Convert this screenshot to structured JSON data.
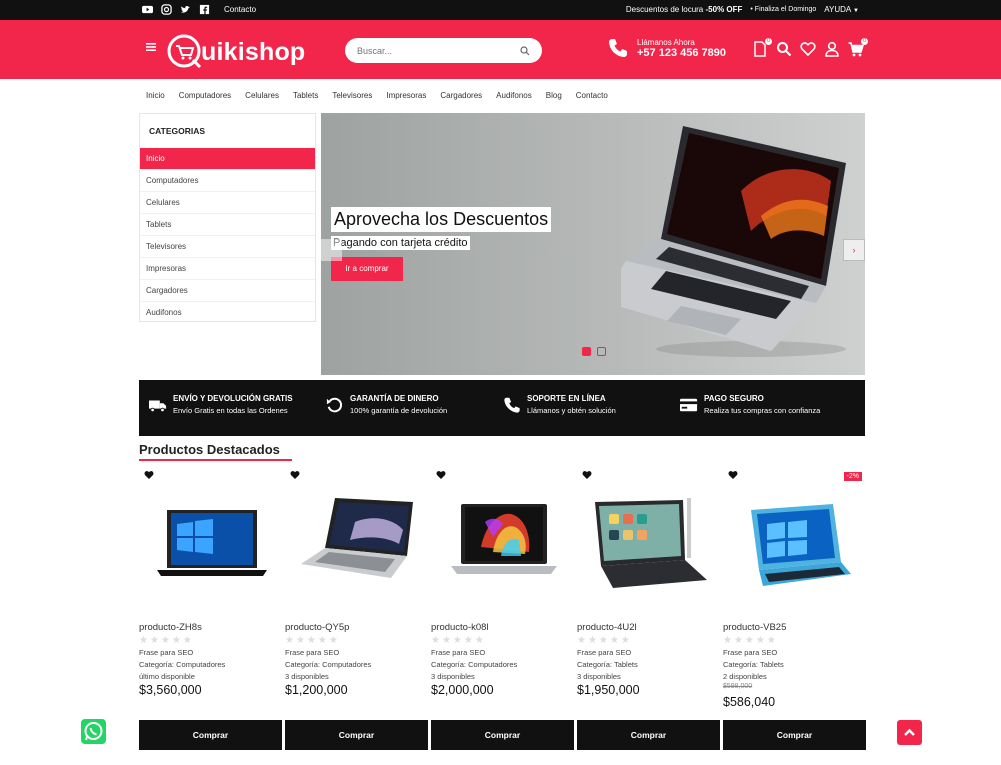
{
  "topbar": {
    "social_icons": [
      "youtube-icon",
      "instagram-icon",
      "twitter-icon",
      "facebook-icon"
    ],
    "contact": "Contacto",
    "promo_prefix": "Descuentos de locura",
    "promo_value": "-50% OFF",
    "promo_suffix": "• Finaliza el Domingo",
    "help": "AYUDA"
  },
  "header": {
    "logo_text": "uikishop",
    "search_placeholder": "Buscar...",
    "call_label": "Llámanos Ahora",
    "phone": "+57 123 456 7890",
    "compare_count": "0",
    "cart_count": "0",
    "icons": [
      "compare-icon",
      "search-icon",
      "heart-icon",
      "user-icon",
      "cart-icon"
    ]
  },
  "nav": [
    "Inicio",
    "Computadores",
    "Celulares",
    "Tablets",
    "Televisores",
    "Impresoras",
    "Cargadores",
    "Audifonos",
    "Blog",
    "Contacto"
  ],
  "sidebar": {
    "title": "CATEGORIAS",
    "items": [
      "Inicio",
      "Computadores",
      "Celulares",
      "Tablets",
      "Televisores",
      "Impresoras",
      "Cargadores",
      "Audifonos"
    ]
  },
  "hero": {
    "title": "Aprovecha los Descuentos",
    "subtitle": "Pagando con tarjeta crédito",
    "button": "Ir a comprar",
    "next": "›"
  },
  "features": [
    {
      "icon": "truck-icon",
      "title": "ENVÍO Y DEVOLUCIÓN GRATIS",
      "sub": "Envío Gratis en todas las Ordenes"
    },
    {
      "icon": "refresh-icon",
      "title": "GARANTÍA DE DINERO",
      "sub": "100% garantía de devolución"
    },
    {
      "icon": "phone-icon",
      "title": "SOPORTE EN LÍNEA",
      "sub": "Llámanos y obtén solución"
    },
    {
      "icon": "card-icon",
      "title": "PAGO SEGURO",
      "sub": "Realiza tus compras con confianza"
    }
  ],
  "products_section": {
    "title": "Productos Destacados",
    "items": [
      {
        "name": "producto-ZH8s",
        "seo": "Frase para SEO",
        "category": "Categoría: Computadores",
        "stock": "último disponible",
        "old_price": "",
        "price": "$3,560,000",
        "discount": "",
        "buy": "Comprar",
        "rating": 0
      },
      {
        "name": "producto-QY5p",
        "seo": "Frase para SEO",
        "category": "Categoría: Computadores",
        "stock": "3 disponibles",
        "old_price": "",
        "price": "$1,200,000",
        "discount": "",
        "buy": "Comprar",
        "rating": 0
      },
      {
        "name": "producto-k08l",
        "seo": "Frase para SEO",
        "category": "Categoría: Computadores",
        "stock": "3 disponibles",
        "old_price": "",
        "price": "$2,000,000",
        "discount": "",
        "buy": "Comprar",
        "rating": 0
      },
      {
        "name": "producto-4U2l",
        "seo": "Frase para SEO",
        "category": "Categoría: Tablets",
        "stock": "3 disponibles",
        "old_price": "",
        "price": "$1,950,000",
        "discount": "",
        "buy": "Comprar",
        "rating": 0
      },
      {
        "name": "producto-VB25",
        "seo": "Frase para SEO",
        "category": "Categoría: Tablets",
        "stock": "2 disponibles",
        "old_price": "$598,000",
        "price": "$586,040",
        "discount": "-2%",
        "buy": "Comprar",
        "rating": 0
      }
    ]
  },
  "colors": {
    "accent": "#f2264b",
    "dark": "#111111"
  }
}
